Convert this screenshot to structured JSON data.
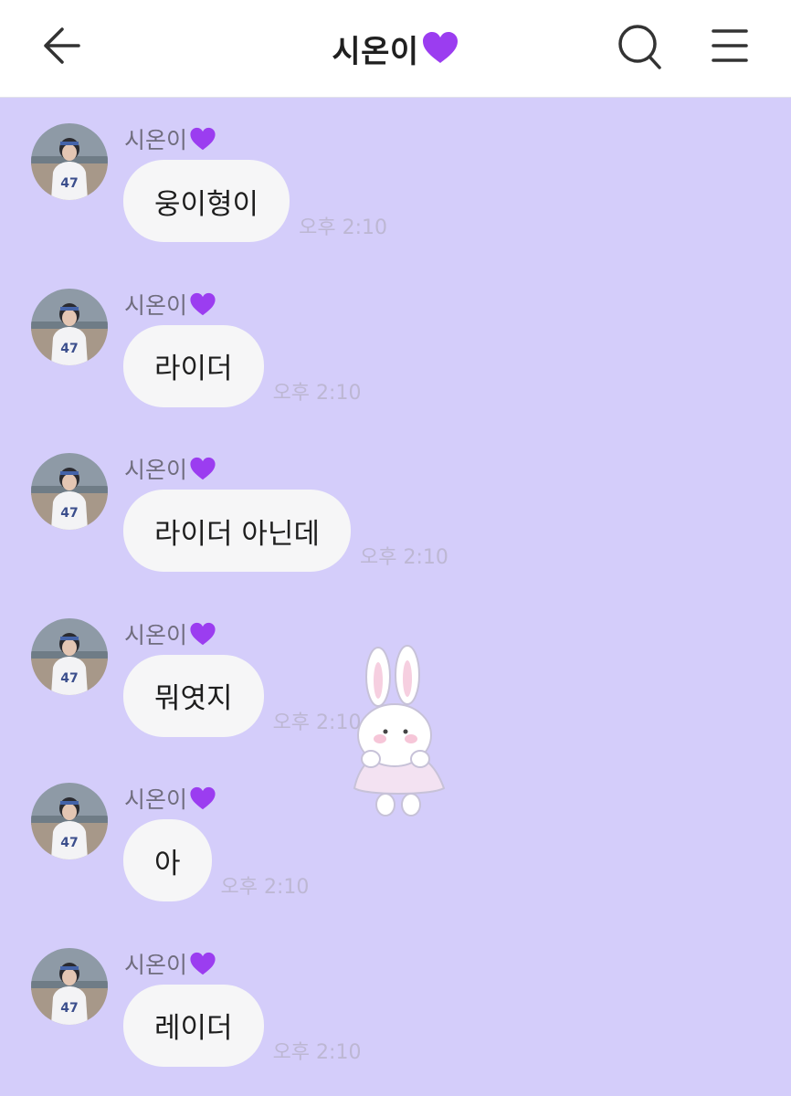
{
  "header": {
    "title": "시온이",
    "title_emoji": "purple-heart",
    "back_icon": "arrow-left-icon",
    "search_icon": "search-icon",
    "menu_icon": "hamburger-menu-icon"
  },
  "theme": {
    "chat_background": "#d4cdfa",
    "bubble": "#f6f6f7",
    "heart": "#9b3df0"
  },
  "messages": [
    {
      "sender": "시온이",
      "text": "웅이형이",
      "time": "오후 2:10"
    },
    {
      "sender": "시온이",
      "text": "라이더",
      "time": "오후 2:10"
    },
    {
      "sender": "시온이",
      "text": "라이더 아닌데",
      "time": "오후 2:10"
    },
    {
      "sender": "시온이",
      "text": "뭐엿지",
      "time": "오후 2:10"
    },
    {
      "sender": "시온이",
      "text": "아",
      "time": "오후 2:10"
    },
    {
      "sender": "시온이",
      "text": "레이더",
      "time": "오후 2:10"
    }
  ],
  "decoration": "bunny-sticker"
}
